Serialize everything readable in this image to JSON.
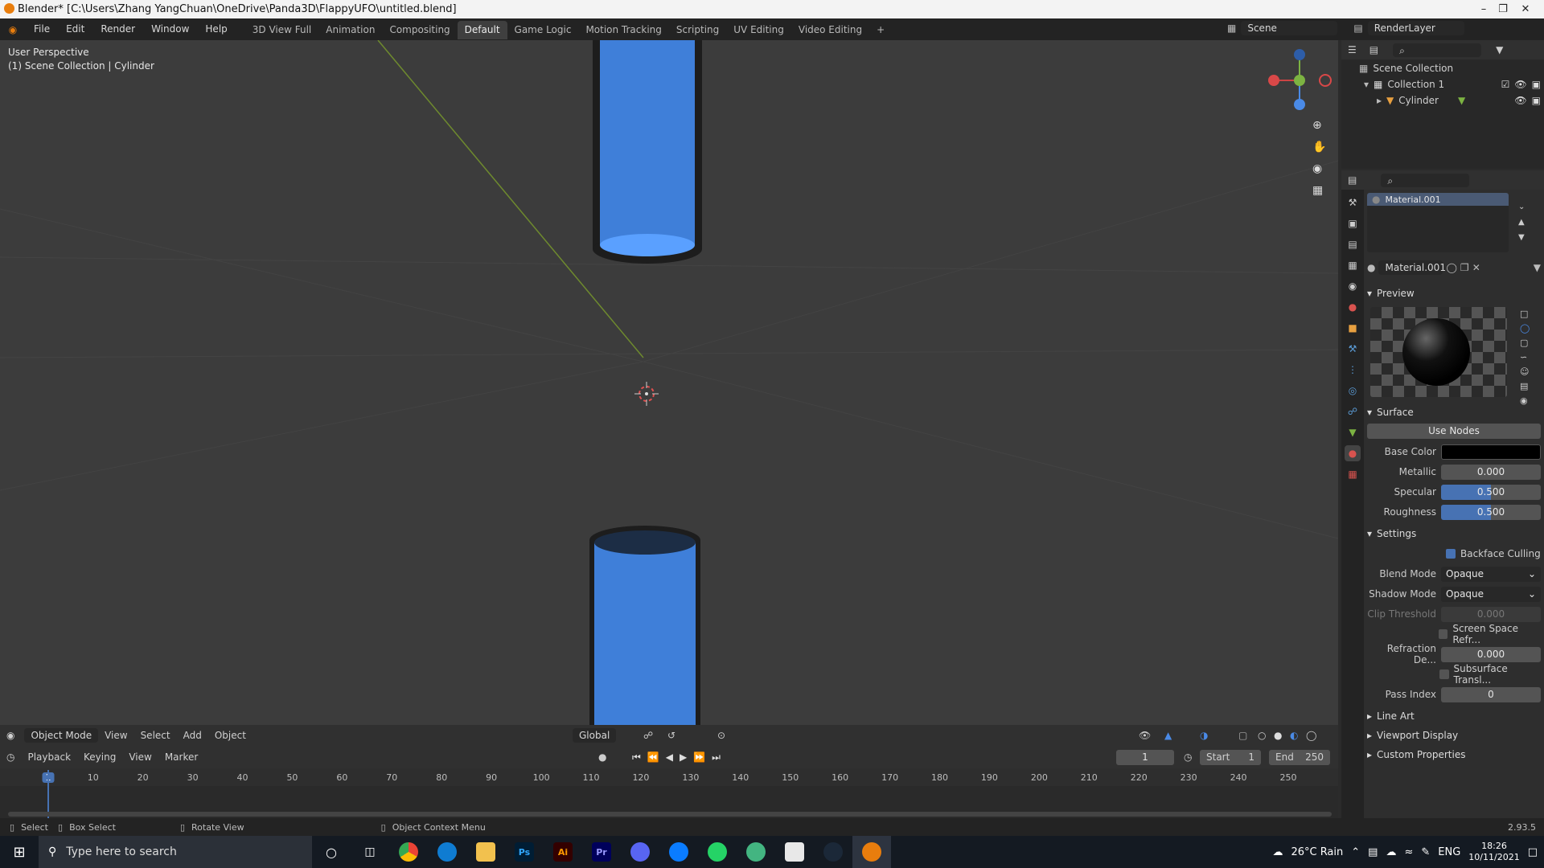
{
  "window": {
    "title": "Blender* [C:\\Users\\Zhang YangChuan\\OneDrive\\Panda3D\\FlappyUFO\\untitled.blend]"
  },
  "menu": [
    "File",
    "Edit",
    "Render",
    "Window",
    "Help"
  ],
  "workspaces": [
    {
      "label": "3D View Full",
      "active": false
    },
    {
      "label": "Animation",
      "active": false
    },
    {
      "label": "Compositing",
      "active": false
    },
    {
      "label": "Default",
      "active": true
    },
    {
      "label": "Game Logic",
      "active": false
    },
    {
      "label": "Motion Tracking",
      "active": false
    },
    {
      "label": "Scripting",
      "active": false
    },
    {
      "label": "UV Editing",
      "active": false
    },
    {
      "label": "Video Editing",
      "active": false
    }
  ],
  "scene": {
    "scene_name": "Scene",
    "render_layer": "RenderLayer"
  },
  "viewport": {
    "perspective": "User Perspective",
    "context": "(1) Scene Collection | Cylinder",
    "mode": "Object Mode",
    "header_menus": [
      "View",
      "Select",
      "Add",
      "Object"
    ],
    "orientation": "Global",
    "colors": {
      "cylinder": "#3f7fd9",
      "cylinder_top": "#5aa0ff",
      "background": "#3c3c3c"
    }
  },
  "outliner": {
    "root": "Scene Collection",
    "items": [
      {
        "label": "Collection 1"
      },
      {
        "label": "Cylinder"
      }
    ]
  },
  "material": {
    "slot": "Material.001",
    "name": "Material.001",
    "sections": {
      "preview": "Preview",
      "surface": "Surface",
      "settings": "Settings",
      "line_art": "Line Art",
      "viewport_display": "Viewport Display",
      "custom_properties": "Custom Properties"
    },
    "use_nodes": "Use Nodes",
    "base_color_label": "Base Color",
    "base_color": "#000000",
    "metallic_label": "Metallic",
    "metallic": "0.000",
    "specular_label": "Specular",
    "specular": "0.500",
    "roughness_label": "Roughness",
    "roughness": "0.500",
    "backface_culling": "Backface Culling",
    "blend_mode_label": "Blend Mode",
    "blend_mode": "Opaque",
    "shadow_mode_label": "Shadow Mode",
    "shadow_mode": "Opaque",
    "clip_threshold_label": "Clip Threshold",
    "clip_threshold": "0.000",
    "screen_space_refr": "Screen Space Refr...",
    "refraction_depth_label": "Refraction De...",
    "refraction_depth": "0.000",
    "subsurface": "Subsurface Transl...",
    "pass_index_label": "Pass Index",
    "pass_index": "0"
  },
  "timeline": {
    "menus": [
      "Playback",
      "Keying",
      "View",
      "Marker"
    ],
    "current_frame": "1",
    "start_label": "Start",
    "start": "1",
    "end_label": "End",
    "end": "250",
    "ticks": [
      "1",
      "10",
      "20",
      "30",
      "40",
      "50",
      "60",
      "70",
      "80",
      "90",
      "100",
      "110",
      "120",
      "130",
      "140",
      "150",
      "160",
      "170",
      "180",
      "190",
      "200",
      "210",
      "220",
      "230",
      "240",
      "250"
    ]
  },
  "statusbar": {
    "select": "Select",
    "box_select": "Box Select",
    "rotate_view": "Rotate View",
    "context_menu": "Object Context Menu",
    "version": "2.93.5"
  },
  "taskbar": {
    "search_placeholder": "Type here to search",
    "weather": "26°C  Rain",
    "lang": "ENG",
    "time": "18:26",
    "date": "10/11/2021"
  }
}
